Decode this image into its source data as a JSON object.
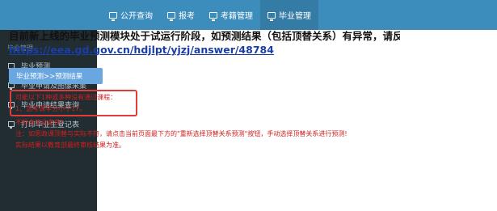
{
  "nav": {
    "items": [
      {
        "label": "公开查询",
        "icon": "monitor-icon"
      },
      {
        "label": "报考",
        "icon": "monitor-icon"
      },
      {
        "label": "考籍管理",
        "icon": "monitor-icon"
      },
      {
        "label": "毕业管理",
        "icon": "monitor-icon",
        "active": true
      }
    ]
  },
  "sidebar": {
    "header": "毕业管理",
    "items": [
      {
        "label": "毕业预测",
        "icon": "monitor-icon"
      },
      {
        "label": "毕业申请及图像采集",
        "icon": "monitor-icon"
      },
      {
        "label": "毕业申请结果查询",
        "icon": "monitor-icon"
      },
      {
        "label": "打印毕业生登记表",
        "icon": "monitor-icon"
      }
    ]
  },
  "main": {
    "notice": "目前新上线的毕业预测模块处于试运行阶段，如预测结果（包括顶替关系）有异常，请反馈至",
    "link": "https://eea.gd.gov.cn/hdjlpt/yjzj/answer/48784",
    "tab_label": "毕业预测>>预测结果",
    "messages": [
      "可能以下1种或多种没有通过课程：",
      "1、选考课学分小于17。",
      "不符合毕业条件!",
      "注：如思政课顶替与实际不符，请点击当前页面最下方的\"重新选择顶替关系预测\"按钮，手动选择顶替关系进行预测!",
      "实际结果以教育部最终审核结果为准。"
    ]
  },
  "colors": {
    "topbar": "#3c8dbc",
    "sidebar": "#222d32",
    "highlight_box": "#e23b3b",
    "message_text": "#d21f1f",
    "link": "#1a3ea8",
    "tab_button": "#6aa6e0"
  }
}
